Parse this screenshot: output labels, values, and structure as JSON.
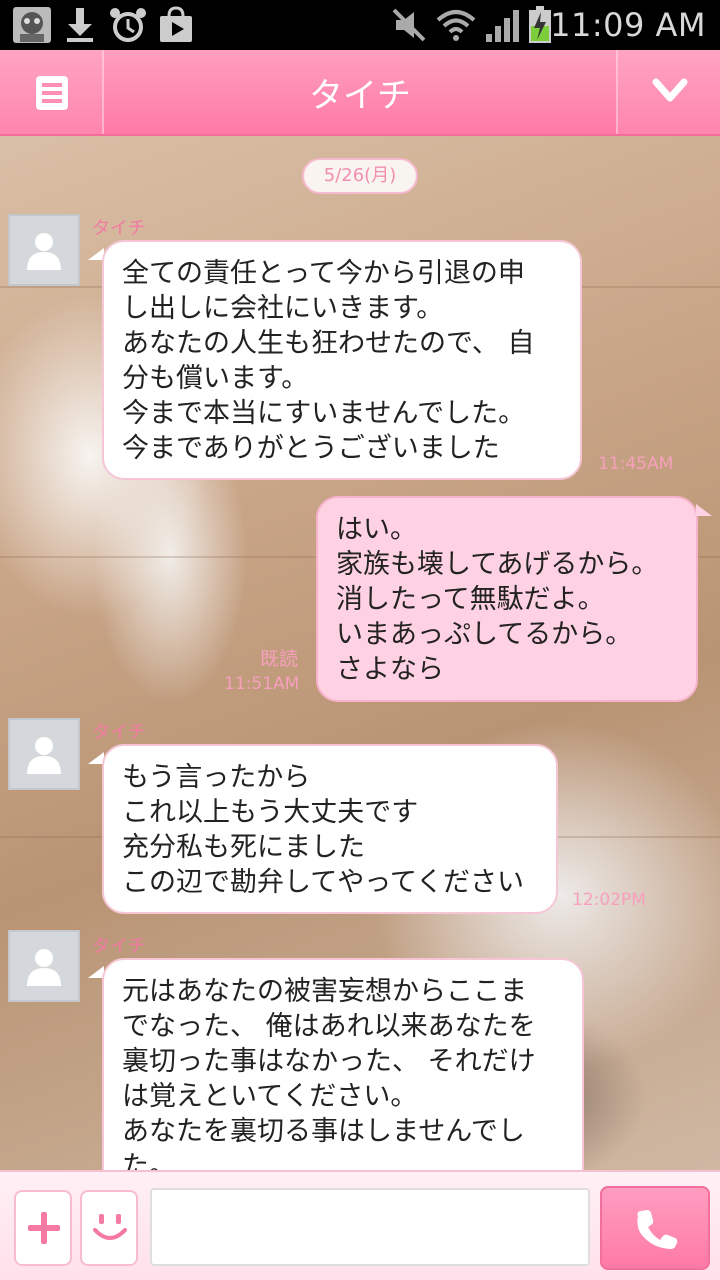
{
  "status_bar": {
    "time": "11:09 AM",
    "icons": [
      "app-avatar-icon",
      "download-icon",
      "alarm-icon",
      "store-bag-icon",
      "mute-icon",
      "wifi-icon",
      "signal-icon",
      "battery-charging-icon"
    ]
  },
  "header": {
    "title": "タイチ",
    "menu_icon": "menu-icon",
    "dropdown_icon": "chevron-down-icon"
  },
  "chat": {
    "date": "5/26(月)",
    "messages": [
      {
        "side": "in",
        "sender": "タイチ",
        "text": "全ての責任とって今から引退の申\nし出しに会社にいきます。\nあなたの人生も狂わせたので、 自\n分も償います。\n今まで本当にすいませんでした。\n今までありがとうございました",
        "time": "11:45AM"
      },
      {
        "side": "out",
        "text": "はい。\n家族も壊してあげるから。\n消したって無駄だよ。\nいまあっぷしてるから。\nさよなら",
        "read": "既読",
        "time": "11:51AM"
      },
      {
        "side": "in",
        "sender": "タイチ",
        "text": "もう言ったから\nこれ以上もう大丈夫です\n充分私も死にました\nこの辺で勘弁してやってください",
        "time": "12:02PM"
      },
      {
        "side": "in",
        "sender": "タイチ",
        "text": "元はあなたの被害妄想からここま\nでなった、 俺はあれ以来あなたを\n裏切った事はなかった、 それだけ\nは覚えといてください。\nあなたを裏切る事はしませんでし\nた。"
      }
    ]
  },
  "input_bar": {
    "add_icon": "plus-icon",
    "emoji_icon": "smiley-icon",
    "message_value": "",
    "call_icon": "phone-icon"
  },
  "colors": {
    "accent_pink": "#ff7aa6",
    "bubble_out": "#ffd2e3",
    "timestamp_pink": "#f7a0bd"
  }
}
